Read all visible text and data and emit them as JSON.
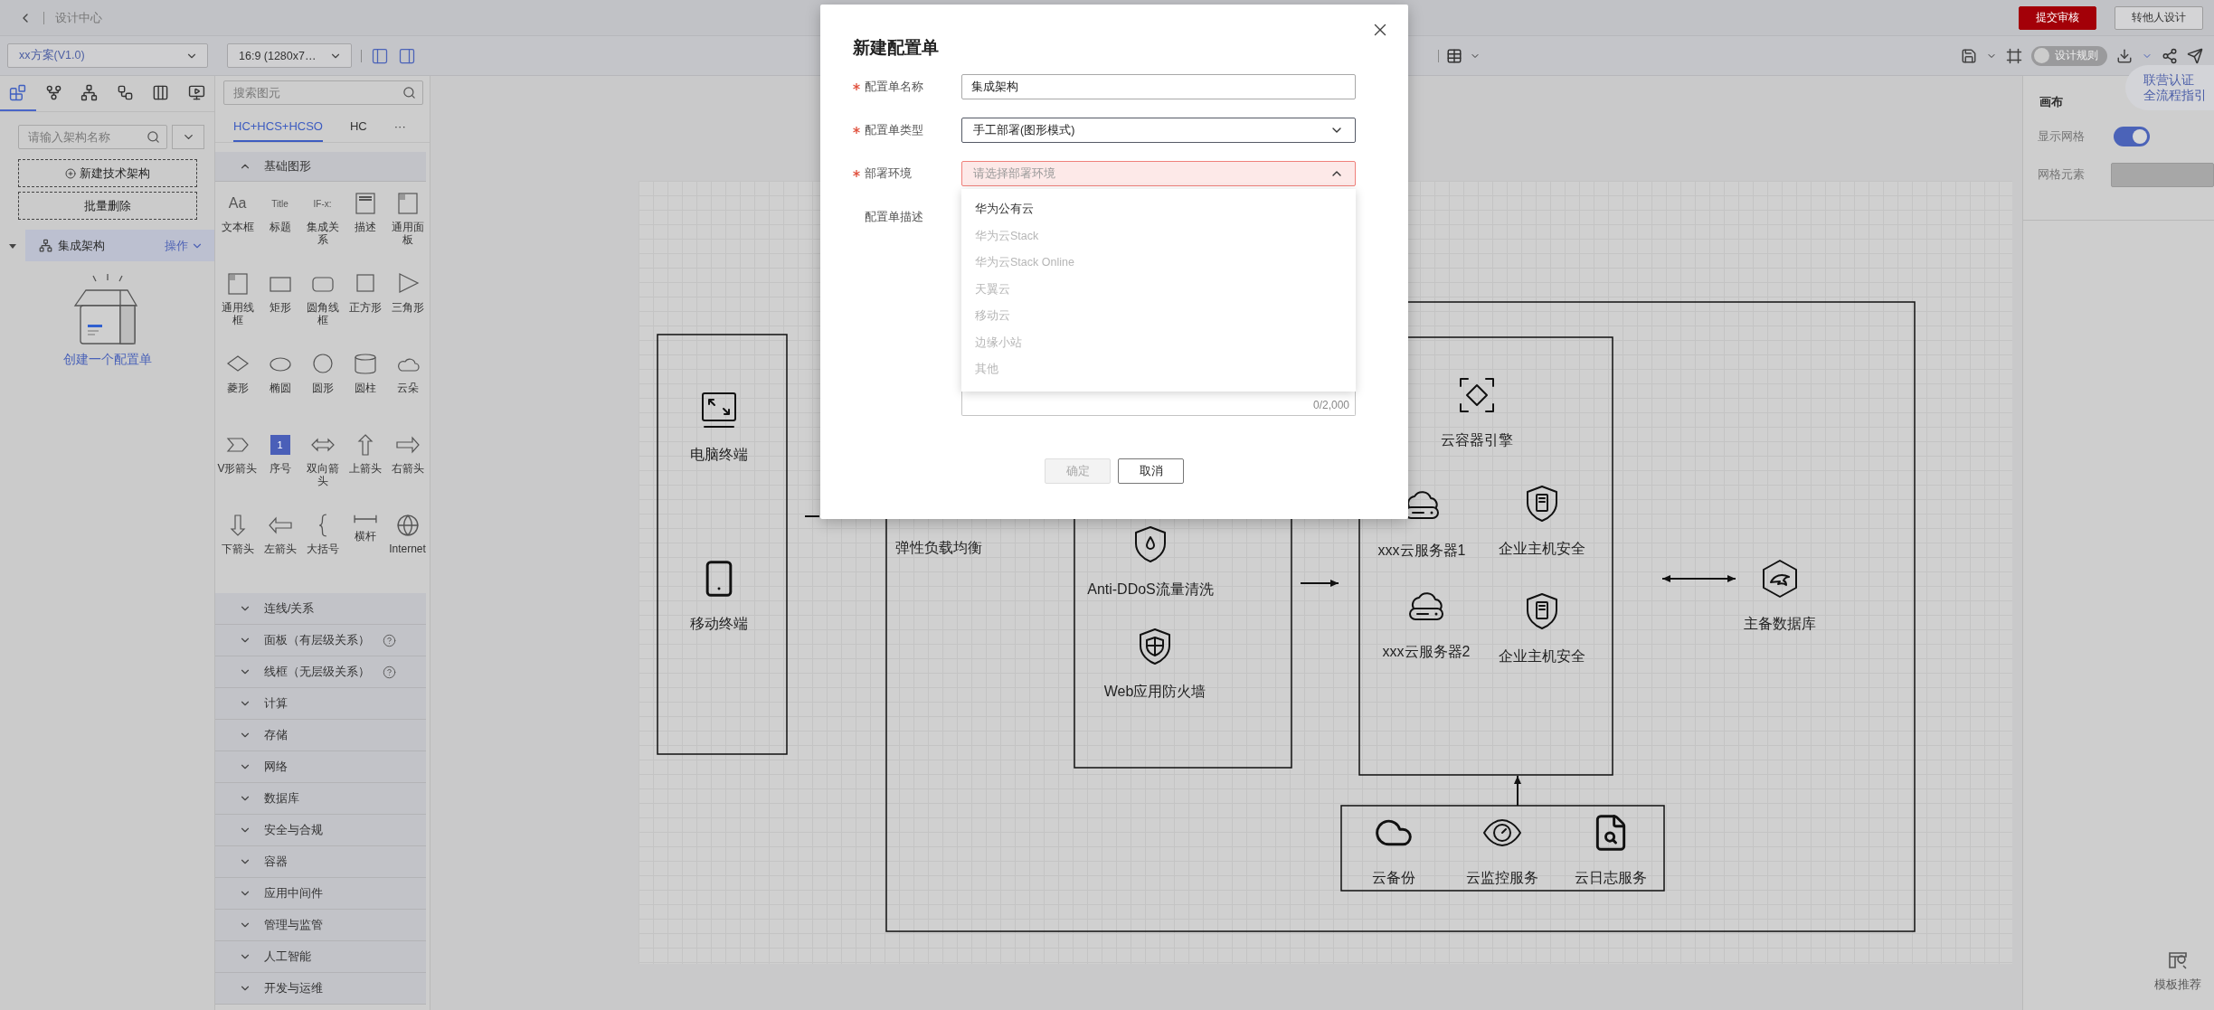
{
  "top_bar": {
    "title": "设计中心",
    "buttons": [
      {
        "label": "提交审核",
        "kind": "primary"
      },
      {
        "label": "转他人设计",
        "kind": "default"
      }
    ]
  },
  "toolbar": {
    "scheme_select": "xx方案(V1.0)",
    "ratio_select": "16:9 (1280x7…",
    "design_rules": {
      "label": "设计规则",
      "on": false
    }
  },
  "left_panel": {
    "tabs": [
      {
        "selected": true
      },
      {
        "selected": false
      },
      {
        "selected": false
      },
      {
        "selected": false
      },
      {
        "selected": false
      },
      {
        "selected": false
      }
    ],
    "search": {
      "placeholder": "请输入架构名称"
    },
    "buttons": [
      {
        "label": "新建技术架构",
        "kind": "add"
      },
      {
        "label": "批量删除",
        "kind": "plain"
      }
    ],
    "tree": [
      {
        "label": "集成架构",
        "action": "操作",
        "expanded": true,
        "selected": true
      }
    ],
    "empty_text": "创建一个配置单"
  },
  "palette": {
    "search": {
      "placeholder": "搜索图元"
    },
    "tabs": [
      {
        "label": "HC+HCS+HCSO",
        "selected": true
      },
      {
        "label": "HC",
        "selected": false
      },
      {
        "label": "···",
        "selected": false
      }
    ],
    "sections": [
      {
        "label": "基础图形",
        "expanded": true,
        "items": [
          {
            "label": "文本框",
            "kind": "text",
            "glyph": "Aa"
          },
          {
            "label": "标题",
            "kind": "title",
            "glyph": "Title"
          },
          {
            "label": "集成关系",
            "kind": "relation",
            "glyph": "IF-x:"
          },
          {
            "label": "描述",
            "kind": "desc"
          },
          {
            "label": "通用面板",
            "kind": "panel"
          },
          {
            "label": "通用线框",
            "kind": "panel"
          },
          {
            "label": "矩形",
            "kind": "rect"
          },
          {
            "label": "圆角线框",
            "kind": "rounded"
          },
          {
            "label": "正方形",
            "kind": "square"
          },
          {
            "label": "三角形",
            "kind": "triangle"
          },
          {
            "label": "菱形",
            "kind": "diamond"
          },
          {
            "label": "椭圆",
            "kind": "ellipse"
          },
          {
            "label": "圆形",
            "kind": "circle"
          },
          {
            "label": "圆柱",
            "kind": "cylinder"
          },
          {
            "label": "云朵",
            "kind": "cloud"
          },
          {
            "label": "V形箭头",
            "kind": "chevron"
          },
          {
            "label": "序号",
            "kind": "number",
            "glyph": "1"
          },
          {
            "label": "双向箭头",
            "kind": "double-arrow"
          },
          {
            "label": "上箭头",
            "kind": "up-arrow"
          },
          {
            "label": "右箭头",
            "kind": "right-arrow"
          },
          {
            "label": "下箭头",
            "kind": "down-arrow"
          },
          {
            "label": "左箭头",
            "kind": "left-arrow"
          },
          {
            "label": "大括号",
            "kind": "brace"
          },
          {
            "label": "横杆",
            "kind": "bar"
          },
          {
            "label": "Internet",
            "kind": "globe"
          }
        ]
      },
      {
        "label": "连线/关系",
        "expanded": false
      },
      {
        "label": "面板（有层级关系）",
        "expanded": false,
        "help": true
      },
      {
        "label": "线框（无层级关系）",
        "expanded": false,
        "help": true
      },
      {
        "label": "计算",
        "expanded": false
      },
      {
        "label": "存储",
        "expanded": false
      },
      {
        "label": "网络",
        "expanded": false
      },
      {
        "label": "数据库",
        "expanded": false
      },
      {
        "label": "安全与合规",
        "expanded": false
      },
      {
        "label": "容器",
        "expanded": false
      },
      {
        "label": "应用中间件",
        "expanded": false
      },
      {
        "label": "管理与监管",
        "expanded": false
      },
      {
        "label": "人工智能",
        "expanded": false
      },
      {
        "label": "开发与运维",
        "expanded": false
      }
    ]
  },
  "canvas": {
    "nodes": [
      {
        "label": "电脑终端",
        "kind": "monitor"
      },
      {
        "label": "移动终端",
        "kind": "phone"
      },
      {
        "label": "弹性负载均衡",
        "kind": "text"
      },
      {
        "label": "Anti-DDoS流量清洗",
        "kind": "shield-drop"
      },
      {
        "label": "Web应用防火墙",
        "kind": "shield-shield"
      },
      {
        "label": "云容器引擎",
        "kind": "container"
      },
      {
        "label": "xxx云服务器1",
        "kind": "cloud-server"
      },
      {
        "label": "企业主机安全",
        "kind": "shield-server"
      },
      {
        "label": "xxx云服务器2",
        "kind": "cloud-server"
      },
      {
        "label": "企业主机安全",
        "kind": "shield-server"
      },
      {
        "label": "主备数据库",
        "kind": "database"
      },
      {
        "label": "云备份",
        "kind": "cloud"
      },
      {
        "label": "云监控服务",
        "kind": "eye"
      },
      {
        "label": "云日志服务",
        "kind": "doc-search"
      }
    ]
  },
  "right_panel": {
    "title": "画布",
    "show_grid": {
      "label": "显示网格",
      "on": true
    },
    "grid_element": {
      "label": "网格元素"
    },
    "guide": [
      "联营认证",
      "全流程指引"
    ],
    "template": "模板推荐"
  },
  "dialog": {
    "title": "新建配置单",
    "fields": [
      {
        "label": "配置单名称",
        "required": true,
        "kind": "input",
        "value": "集成架构"
      },
      {
        "label": "配置单类型",
        "required": true,
        "kind": "select",
        "value": "手工部署(图形模式)",
        "error": false,
        "expanded": false
      },
      {
        "label": "部署环境",
        "required": true,
        "kind": "select",
        "placeholder": "请选择部署环境",
        "error": true,
        "expanded": true,
        "options": [
          {
            "label": "华为公有云",
            "disabled": false
          },
          {
            "label": "华为云Stack",
            "disabled": true
          },
          {
            "label": "华为云Stack Online",
            "disabled": true
          },
          {
            "label": "天翼云",
            "disabled": true
          },
          {
            "label": "移动云",
            "disabled": true
          },
          {
            "label": "边缘小站",
            "disabled": true
          },
          {
            "label": "其他",
            "disabled": true
          }
        ]
      },
      {
        "label": "配置单描述",
        "required": false,
        "kind": "textarea",
        "counter": "0/2,000"
      }
    ],
    "buttons": [
      {
        "label": "确定",
        "disabled": true
      },
      {
        "label": "取消",
        "disabled": false
      }
    ]
  }
}
